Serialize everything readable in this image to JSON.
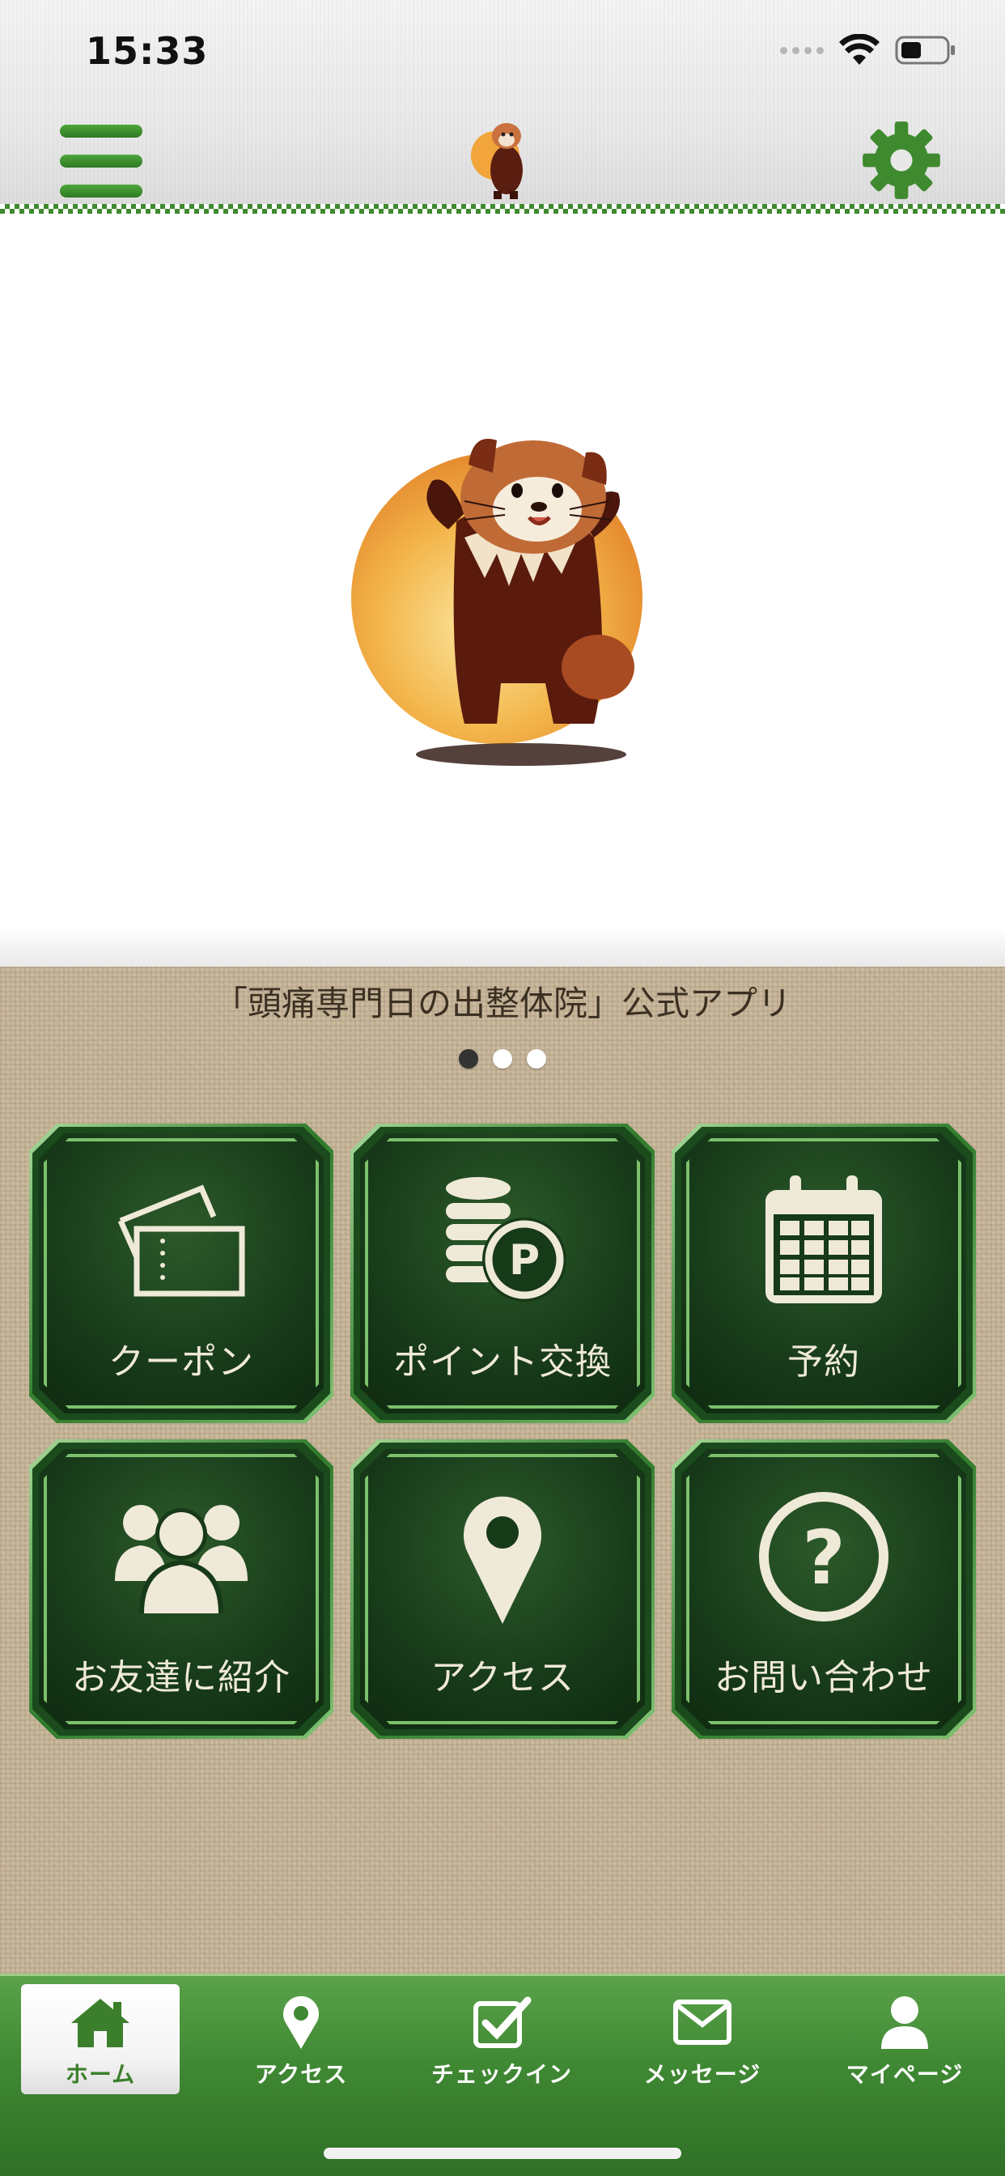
{
  "status_bar": {
    "time": "15:33"
  },
  "header": {
    "menu_icon": "hamburger-menu-icon",
    "logo_icon": "red-panda-mascot",
    "settings_icon": "gear-icon"
  },
  "banner": {
    "image": "red-panda-mascot-illustration",
    "dots": 3,
    "active_dot": 0
  },
  "app_title": "「頭痛専門日の出整体院」公式アプリ",
  "menu_tiles": [
    {
      "label": "クーポン",
      "icon": "ticket-icon"
    },
    {
      "label": "ポイント交換",
      "icon": "coins-points-icon"
    },
    {
      "label": "予約",
      "icon": "calendar-icon"
    },
    {
      "label": "お友達に紹介",
      "icon": "people-group-icon"
    },
    {
      "label": "アクセス",
      "icon": "map-pin-icon"
    },
    {
      "label": "お問い合わせ",
      "icon": "question-circle-icon"
    }
  ],
  "tab_bar": {
    "tabs": [
      {
        "label": "ホーム",
        "icon": "home-icon",
        "active": true
      },
      {
        "label": "アクセス",
        "icon": "map-pin-icon",
        "active": false
      },
      {
        "label": "チェックイン",
        "icon": "checkbox-icon",
        "active": false
      },
      {
        "label": "メッセージ",
        "icon": "envelope-icon",
        "active": false
      },
      {
        "label": "マイページ",
        "icon": "user-icon",
        "active": false
      }
    ]
  },
  "colors": {
    "brand_green": "#3f8a2f",
    "tile_dark_green": "#173a19",
    "tile_text": "#efe9d8",
    "burlap": "#c8b79b"
  }
}
